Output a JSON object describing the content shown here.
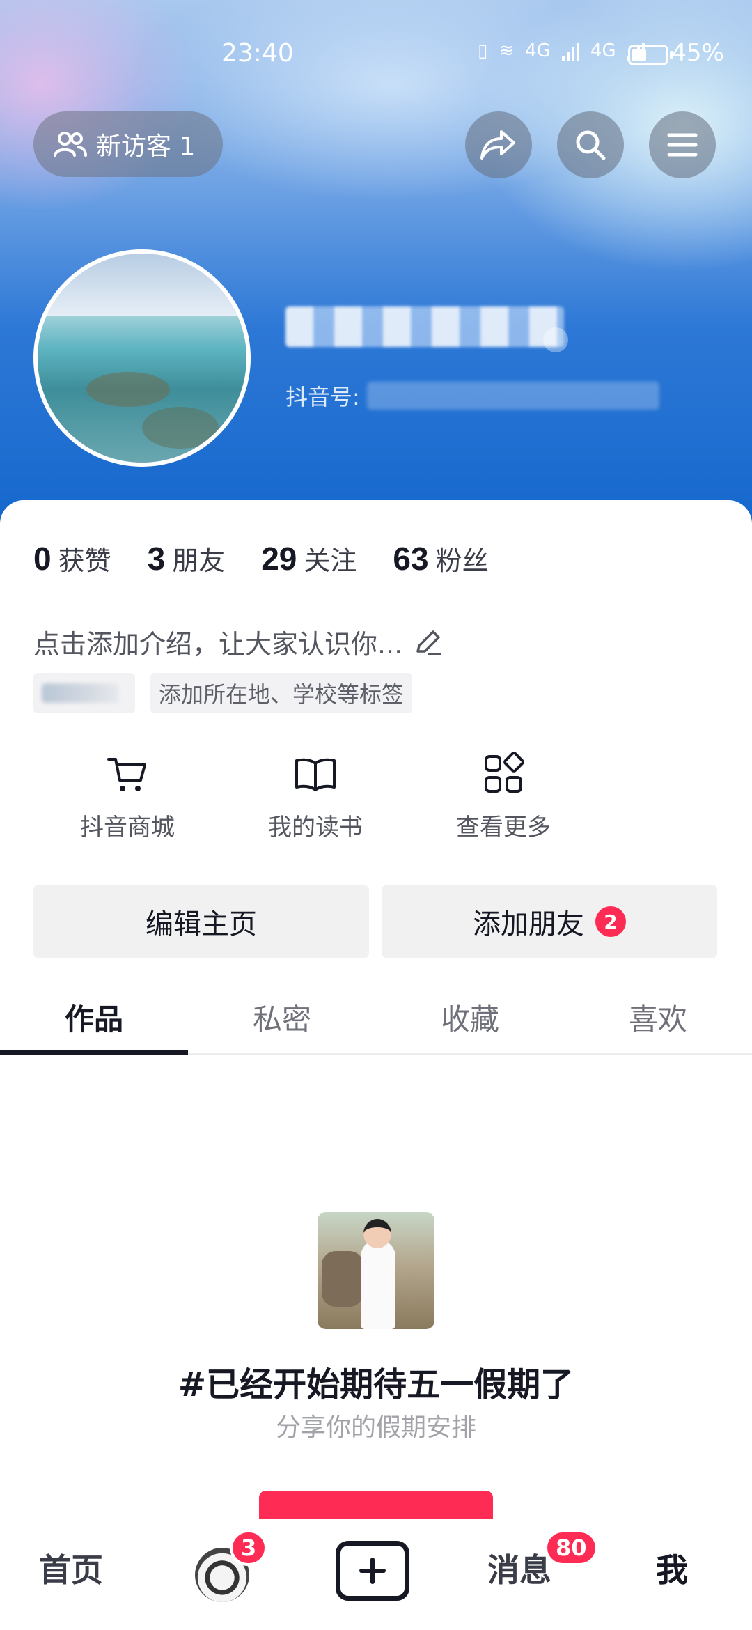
{
  "status_bar": {
    "time": "23:40",
    "network_1": "4G",
    "network_2": "4G",
    "battery": "45%"
  },
  "header": {
    "visitor_label": "新访客 1",
    "id_prefix": "抖音号:"
  },
  "stats": [
    {
      "num": "0",
      "label": "获赞"
    },
    {
      "num": "3",
      "label": "朋友"
    },
    {
      "num": "29",
      "label": "关注"
    },
    {
      "num": "63",
      "label": "粉丝"
    }
  ],
  "bio": "点击添加介绍，让大家认识你...",
  "tag_placeholder": "添加所在地、学校等标签",
  "shortcuts": [
    {
      "label": "抖音商城",
      "icon": "cart-icon"
    },
    {
      "label": "我的读书",
      "icon": "book-icon"
    },
    {
      "label": "查看更多",
      "icon": "grid-icon"
    }
  ],
  "actions": {
    "edit": "编辑主页",
    "add_friend": "添加朋友",
    "add_friend_badge": "2"
  },
  "tabs": [
    "作品",
    "私密",
    "收藏",
    "喜欢"
  ],
  "promo": {
    "title": "#已经开始期待五一假期了",
    "subtitle": "分享你的假期安排"
  },
  "nav": {
    "home": "首页",
    "friends_badge": "3",
    "messages": "消息",
    "messages_badge": "80",
    "me": "我"
  }
}
